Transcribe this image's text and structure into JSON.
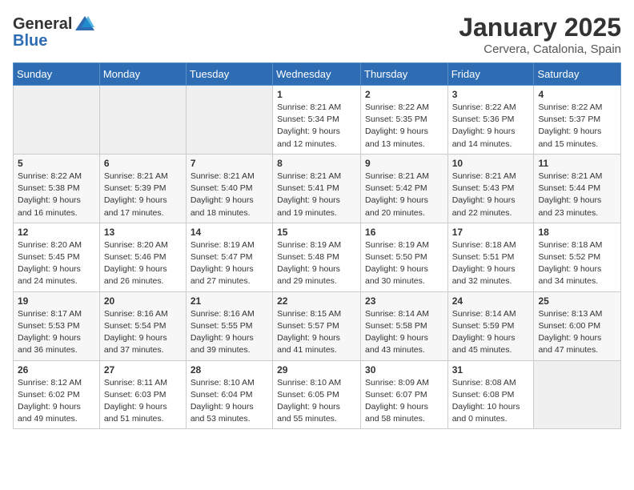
{
  "header": {
    "logo_line1": "General",
    "logo_line2": "Blue",
    "title": "January 2025",
    "subtitle": "Cervera, Catalonia, Spain"
  },
  "weekdays": [
    "Sunday",
    "Monday",
    "Tuesday",
    "Wednesday",
    "Thursday",
    "Friday",
    "Saturday"
  ],
  "weeks": [
    [
      {
        "day": "",
        "info": ""
      },
      {
        "day": "",
        "info": ""
      },
      {
        "day": "",
        "info": ""
      },
      {
        "day": "1",
        "info": "Sunrise: 8:21 AM\nSunset: 5:34 PM\nDaylight: 9 hours\nand 12 minutes."
      },
      {
        "day": "2",
        "info": "Sunrise: 8:22 AM\nSunset: 5:35 PM\nDaylight: 9 hours\nand 13 minutes."
      },
      {
        "day": "3",
        "info": "Sunrise: 8:22 AM\nSunset: 5:36 PM\nDaylight: 9 hours\nand 14 minutes."
      },
      {
        "day": "4",
        "info": "Sunrise: 8:22 AM\nSunset: 5:37 PM\nDaylight: 9 hours\nand 15 minutes."
      }
    ],
    [
      {
        "day": "5",
        "info": "Sunrise: 8:22 AM\nSunset: 5:38 PM\nDaylight: 9 hours\nand 16 minutes."
      },
      {
        "day": "6",
        "info": "Sunrise: 8:21 AM\nSunset: 5:39 PM\nDaylight: 9 hours\nand 17 minutes."
      },
      {
        "day": "7",
        "info": "Sunrise: 8:21 AM\nSunset: 5:40 PM\nDaylight: 9 hours\nand 18 minutes."
      },
      {
        "day": "8",
        "info": "Sunrise: 8:21 AM\nSunset: 5:41 PM\nDaylight: 9 hours\nand 19 minutes."
      },
      {
        "day": "9",
        "info": "Sunrise: 8:21 AM\nSunset: 5:42 PM\nDaylight: 9 hours\nand 20 minutes."
      },
      {
        "day": "10",
        "info": "Sunrise: 8:21 AM\nSunset: 5:43 PM\nDaylight: 9 hours\nand 22 minutes."
      },
      {
        "day": "11",
        "info": "Sunrise: 8:21 AM\nSunset: 5:44 PM\nDaylight: 9 hours\nand 23 minutes."
      }
    ],
    [
      {
        "day": "12",
        "info": "Sunrise: 8:20 AM\nSunset: 5:45 PM\nDaylight: 9 hours\nand 24 minutes."
      },
      {
        "day": "13",
        "info": "Sunrise: 8:20 AM\nSunset: 5:46 PM\nDaylight: 9 hours\nand 26 minutes."
      },
      {
        "day": "14",
        "info": "Sunrise: 8:19 AM\nSunset: 5:47 PM\nDaylight: 9 hours\nand 27 minutes."
      },
      {
        "day": "15",
        "info": "Sunrise: 8:19 AM\nSunset: 5:48 PM\nDaylight: 9 hours\nand 29 minutes."
      },
      {
        "day": "16",
        "info": "Sunrise: 8:19 AM\nSunset: 5:50 PM\nDaylight: 9 hours\nand 30 minutes."
      },
      {
        "day": "17",
        "info": "Sunrise: 8:18 AM\nSunset: 5:51 PM\nDaylight: 9 hours\nand 32 minutes."
      },
      {
        "day": "18",
        "info": "Sunrise: 8:18 AM\nSunset: 5:52 PM\nDaylight: 9 hours\nand 34 minutes."
      }
    ],
    [
      {
        "day": "19",
        "info": "Sunrise: 8:17 AM\nSunset: 5:53 PM\nDaylight: 9 hours\nand 36 minutes."
      },
      {
        "day": "20",
        "info": "Sunrise: 8:16 AM\nSunset: 5:54 PM\nDaylight: 9 hours\nand 37 minutes."
      },
      {
        "day": "21",
        "info": "Sunrise: 8:16 AM\nSunset: 5:55 PM\nDaylight: 9 hours\nand 39 minutes."
      },
      {
        "day": "22",
        "info": "Sunrise: 8:15 AM\nSunset: 5:57 PM\nDaylight: 9 hours\nand 41 minutes."
      },
      {
        "day": "23",
        "info": "Sunrise: 8:14 AM\nSunset: 5:58 PM\nDaylight: 9 hours\nand 43 minutes."
      },
      {
        "day": "24",
        "info": "Sunrise: 8:14 AM\nSunset: 5:59 PM\nDaylight: 9 hours\nand 45 minutes."
      },
      {
        "day": "25",
        "info": "Sunrise: 8:13 AM\nSunset: 6:00 PM\nDaylight: 9 hours\nand 47 minutes."
      }
    ],
    [
      {
        "day": "26",
        "info": "Sunrise: 8:12 AM\nSunset: 6:02 PM\nDaylight: 9 hours\nand 49 minutes."
      },
      {
        "day": "27",
        "info": "Sunrise: 8:11 AM\nSunset: 6:03 PM\nDaylight: 9 hours\nand 51 minutes."
      },
      {
        "day": "28",
        "info": "Sunrise: 8:10 AM\nSunset: 6:04 PM\nDaylight: 9 hours\nand 53 minutes."
      },
      {
        "day": "29",
        "info": "Sunrise: 8:10 AM\nSunset: 6:05 PM\nDaylight: 9 hours\nand 55 minutes."
      },
      {
        "day": "30",
        "info": "Sunrise: 8:09 AM\nSunset: 6:07 PM\nDaylight: 9 hours\nand 58 minutes."
      },
      {
        "day": "31",
        "info": "Sunrise: 8:08 AM\nSunset: 6:08 PM\nDaylight: 10 hours\nand 0 minutes."
      },
      {
        "day": "",
        "info": ""
      }
    ]
  ]
}
